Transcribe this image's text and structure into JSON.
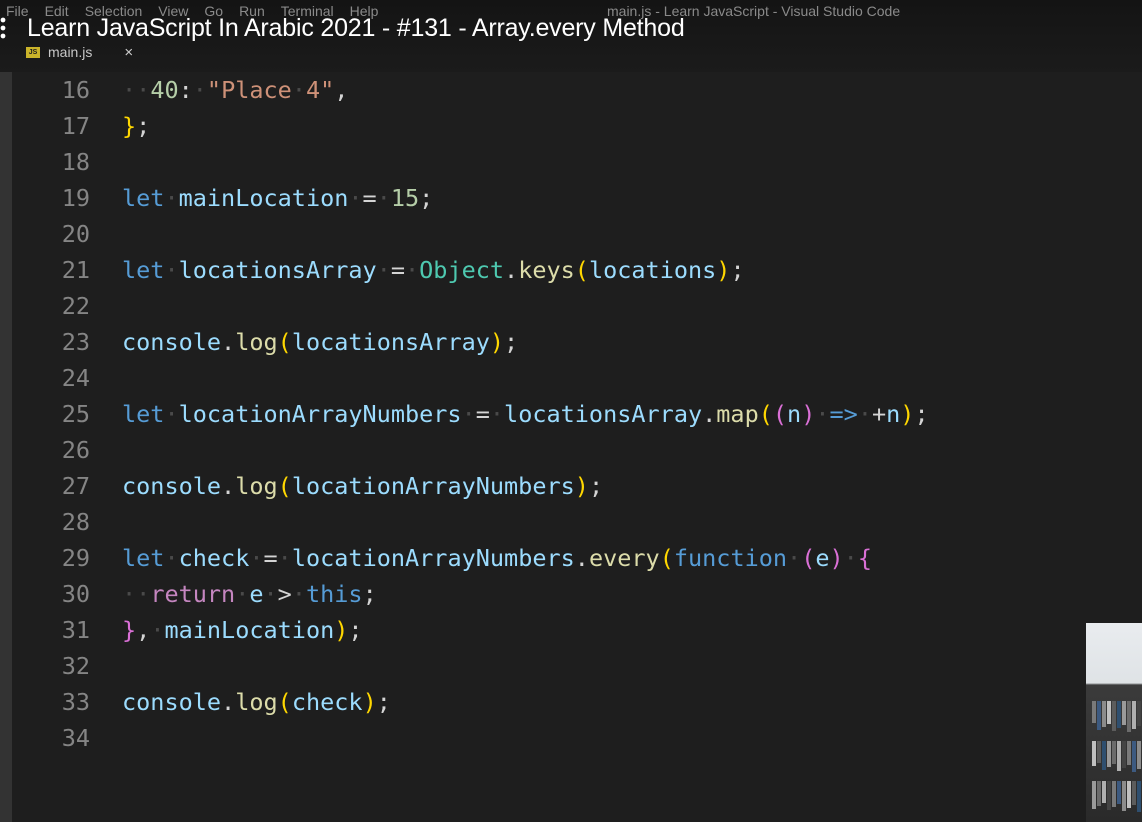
{
  "menu": [
    "File",
    "Edit",
    "Selection",
    "View",
    "Go",
    "Run",
    "Terminal",
    "Help"
  ],
  "window_title": "main.js - Learn JavaScript - Visual Studio Code",
  "video_title": "Learn JavaScript In Arabic 2021 - #131 - Array.every Method",
  "tab": {
    "icon_text": "JS",
    "filename": "main.js",
    "close": "×"
  },
  "editor": {
    "lines": [
      {
        "num": "16",
        "tokens": [
          [
            "ws",
            "·"
          ],
          [
            "ws",
            "·"
          ],
          [
            "num",
            "40"
          ],
          [
            "op",
            ":"
          ],
          [
            "ws",
            "·"
          ],
          [
            "str",
            "\"Place"
          ],
          [
            "ws",
            "·"
          ],
          [
            "str",
            "4\""
          ],
          [
            "op",
            ","
          ]
        ]
      },
      {
        "num": "17",
        "tokens": [
          [
            "b1",
            "}"
          ],
          [
            "op",
            ";"
          ]
        ]
      },
      {
        "num": "18",
        "tokens": []
      },
      {
        "num": "19",
        "tokens": [
          [
            "kw",
            "let"
          ],
          [
            "ws",
            "·"
          ],
          [
            "var",
            "mainLocation"
          ],
          [
            "ws",
            "·"
          ],
          [
            "op",
            "="
          ],
          [
            "ws",
            "·"
          ],
          [
            "num",
            "15"
          ],
          [
            "op",
            ";"
          ]
        ]
      },
      {
        "num": "20",
        "tokens": []
      },
      {
        "num": "21",
        "tokens": [
          [
            "kw",
            "let"
          ],
          [
            "ws",
            "·"
          ],
          [
            "var",
            "locationsArray"
          ],
          [
            "ws",
            "·"
          ],
          [
            "op",
            "="
          ],
          [
            "ws",
            "·"
          ],
          [
            "cls",
            "Object"
          ],
          [
            "op",
            "."
          ],
          [
            "fn",
            "keys"
          ],
          [
            "b1",
            "("
          ],
          [
            "var",
            "locations"
          ],
          [
            "b1",
            ")"
          ],
          [
            "op",
            ";"
          ]
        ]
      },
      {
        "num": "22",
        "tokens": []
      },
      {
        "num": "23",
        "tokens": [
          [
            "var",
            "console"
          ],
          [
            "op",
            "."
          ],
          [
            "fn",
            "log"
          ],
          [
            "b1",
            "("
          ],
          [
            "var",
            "locationsArray"
          ],
          [
            "b1",
            ")"
          ],
          [
            "op",
            ";"
          ]
        ]
      },
      {
        "num": "24",
        "tokens": []
      },
      {
        "num": "25",
        "tokens": [
          [
            "kw",
            "let"
          ],
          [
            "ws",
            "·"
          ],
          [
            "var",
            "locationArrayNumbers"
          ],
          [
            "ws",
            "·"
          ],
          [
            "op",
            "="
          ],
          [
            "ws",
            "·"
          ],
          [
            "var",
            "locationsArray"
          ],
          [
            "op",
            "."
          ],
          [
            "fn",
            "map"
          ],
          [
            "b1",
            "("
          ],
          [
            "b2",
            "("
          ],
          [
            "var",
            "n"
          ],
          [
            "b2",
            ")"
          ],
          [
            "ws",
            "·"
          ],
          [
            "kw",
            "=>"
          ],
          [
            "ws",
            "·"
          ],
          [
            "op",
            "+"
          ],
          [
            "var",
            "n"
          ],
          [
            "b1",
            ")"
          ],
          [
            "op",
            ";"
          ]
        ]
      },
      {
        "num": "26",
        "tokens": []
      },
      {
        "num": "27",
        "tokens": [
          [
            "var",
            "console"
          ],
          [
            "op",
            "."
          ],
          [
            "fn",
            "log"
          ],
          [
            "b1",
            "("
          ],
          [
            "var",
            "locationArrayNumbers"
          ],
          [
            "b1",
            ")"
          ],
          [
            "op",
            ";"
          ]
        ]
      },
      {
        "num": "28",
        "tokens": []
      },
      {
        "num": "29",
        "tokens": [
          [
            "kw",
            "let"
          ],
          [
            "ws",
            "·"
          ],
          [
            "var",
            "check"
          ],
          [
            "ws",
            "·"
          ],
          [
            "op",
            "="
          ],
          [
            "ws",
            "·"
          ],
          [
            "var",
            "locationArrayNumbers"
          ],
          [
            "op",
            "."
          ],
          [
            "fn",
            "every"
          ],
          [
            "b1",
            "("
          ],
          [
            "kw",
            "function"
          ],
          [
            "ws",
            "·"
          ],
          [
            "b2",
            "("
          ],
          [
            "var",
            "e"
          ],
          [
            "b2",
            ")"
          ],
          [
            "ws",
            "·"
          ],
          [
            "b2",
            "{"
          ]
        ]
      },
      {
        "num": "30",
        "tokens": [
          [
            "ws",
            "·"
          ],
          [
            "ws",
            "·"
          ],
          [
            "kw2",
            "return"
          ],
          [
            "ws",
            "·"
          ],
          [
            "var",
            "e"
          ],
          [
            "ws",
            "·"
          ],
          [
            "op",
            ">"
          ],
          [
            "ws",
            "·"
          ],
          [
            "kw",
            "this"
          ],
          [
            "op",
            ";"
          ]
        ]
      },
      {
        "num": "31",
        "tokens": [
          [
            "b2",
            "}"
          ],
          [
            "op",
            ","
          ],
          [
            "ws",
            "·"
          ],
          [
            "var",
            "mainLocation"
          ],
          [
            "b1",
            ")"
          ],
          [
            "op",
            ";"
          ]
        ]
      },
      {
        "num": "32",
        "tokens": []
      },
      {
        "num": "33",
        "tokens": [
          [
            "var",
            "console"
          ],
          [
            "op",
            "."
          ],
          [
            "fn",
            "log"
          ],
          [
            "b1",
            "("
          ],
          [
            "var",
            "check"
          ],
          [
            "b1",
            ")"
          ],
          [
            "op",
            ";"
          ]
        ]
      },
      {
        "num": "34",
        "tokens": []
      }
    ]
  },
  "colors": {
    "background": "#1e1e1e",
    "keyword": "#569cd6",
    "control_keyword": "#c586c0",
    "variable": "#9cdcfe",
    "function": "#dcdcaa",
    "class": "#4ec9b0",
    "number": "#b5cea8",
    "string": "#ce9178",
    "bracket_level1": "#ffd700",
    "bracket_level2": "#da70d6",
    "line_number": "#858585"
  },
  "icons": {
    "overlay_menu": "more-vertical-icon",
    "file_type": "javascript-file-icon",
    "close": "close-icon"
  }
}
